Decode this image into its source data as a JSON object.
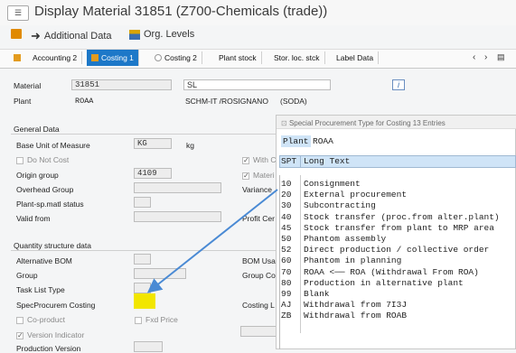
{
  "window": {
    "title": "Display Material 31851 (Z700-Chemicals (trade))"
  },
  "toolbar": {
    "additional_data": "Additional Data",
    "org_levels": "Org. Levels"
  },
  "tabs": [
    {
      "label": "Accounting 2",
      "active": false
    },
    {
      "label": "Costing 1",
      "active": true
    },
    {
      "label": "Costing 2",
      "active": false
    },
    {
      "label": "Plant stock",
      "active": false
    },
    {
      "label": "Stor. loc. stck",
      "active": false
    },
    {
      "label": "Label Data",
      "active": false
    }
  ],
  "header": {
    "material_label": "Material",
    "material_value": "31851",
    "material_desc": "SL",
    "plant_label": "Plant",
    "plant_value": "ROAA",
    "plant_desc": "SCHM-IT /ROSIGNANO",
    "plant_desc2": "(SODA)",
    "info_icon": "i"
  },
  "general": {
    "title": "General Data",
    "base_uom_label": "Base Unit of Measure",
    "base_uom_value": "KG",
    "base_uom_unit": "kg",
    "do_not_cost": "Do Not Cost",
    "with_c": "With C",
    "origin_group_label": "Origin group",
    "origin_group_value": "4109",
    "materi": "Materi",
    "overhead_group_label": "Overhead Group",
    "variance": "Variance",
    "plant_sp_label": "Plant-sp.matl status",
    "valid_from_label": "Valid from",
    "profit_cer": "Profit Cer"
  },
  "quantity": {
    "title": "Quantity structure data",
    "alt_bom_label": "Alternative BOM",
    "bom_usa": "BOM Usa",
    "group_label": "Group",
    "group_co": "Group Co",
    "task_list_label": "Task List Type",
    "specprocurem_label": "SpecProcurem Costing",
    "costing_l": "Costing L",
    "co_product": "Co-product",
    "fxd_price": "Fxd Price",
    "version_indicator": "Version Indicator",
    "production_version": "Production Version"
  },
  "popup": {
    "title": "Special Procurement Type for Costing 13 Entries",
    "plant_tag": "Plant",
    "plant_value": "ROAA",
    "col_spt": "SPT",
    "col_long_text": "Long Text",
    "rows": [
      {
        "spt": "10",
        "text": "Consignment"
      },
      {
        "spt": "20",
        "text": "External procurement"
      },
      {
        "spt": "30",
        "text": "Subcontracting"
      },
      {
        "spt": "40",
        "text": "Stock transfer (proc.from alter.plant)"
      },
      {
        "spt": "45",
        "text": "Stock transfer from plant to MRP area"
      },
      {
        "spt": "50",
        "text": "Phantom assembly"
      },
      {
        "spt": "52",
        "text": "Direct production / collective order"
      },
      {
        "spt": "60",
        "text": "Phantom in planning"
      },
      {
        "spt": "70",
        "text": "ROAA <── ROA (Withdrawal From ROA)"
      },
      {
        "spt": "80",
        "text": "Production in alternative plant"
      },
      {
        "spt": "99",
        "text": "Blank"
      },
      {
        "spt": "AJ",
        "text": "Withdrawal from 7I3J"
      },
      {
        "spt": "ZB",
        "text": "Withdrawal from ROAB"
      }
    ]
  },
  "colors": {
    "active_tab": "#1d78c8",
    "highlight": "#f2e600",
    "arrow": "#4a8ad4",
    "popup_header": "#cfe4f7"
  }
}
